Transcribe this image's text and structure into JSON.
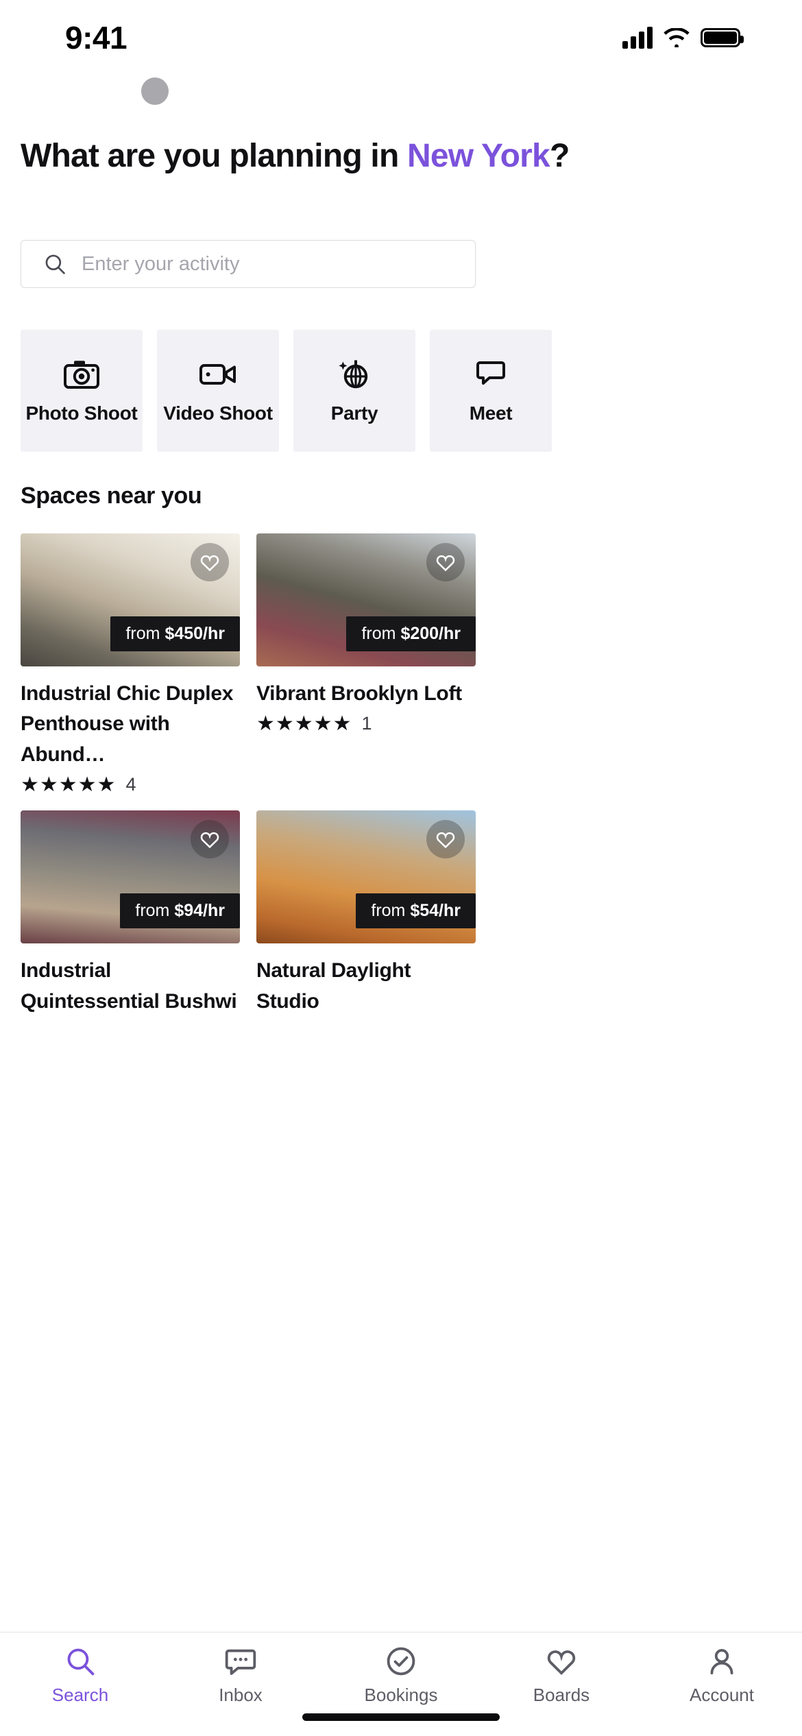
{
  "status_bar": {
    "time": "9:41",
    "signal_icon": "cellular-signal-icon",
    "wifi_icon": "wifi-icon",
    "battery_icon": "battery-icon"
  },
  "header": {
    "avatar_name": "user-avatar",
    "title_line1": "What are you planning in",
    "city": "New York",
    "title_suffix": "?"
  },
  "search": {
    "icon": "search-icon",
    "placeholder": "Enter your activity",
    "value": ""
  },
  "categories": [
    {
      "label": "Photo Shoot",
      "icon": "camera-icon"
    },
    {
      "label": "Video Shoot",
      "icon": "video-camera-icon"
    },
    {
      "label": "Party",
      "icon": "disco-ball-icon"
    },
    {
      "label": "Meet",
      "icon": "meeting-icon"
    }
  ],
  "section": {
    "title": "Spaces near you"
  },
  "listings": [
    {
      "title": "Industrial Chic Duplex Penthouse with Abund…",
      "price_prefix": "from",
      "price": "$450/hr",
      "stars": "★★★★★",
      "reviews": "4",
      "favorite_icon": "heart-icon"
    },
    {
      "title": "Vibrant Brooklyn Loft",
      "price_prefix": "from",
      "price": "$200/hr",
      "stars": "★★★★★",
      "reviews": "1",
      "favorite_icon": "heart-icon"
    },
    {
      "title": "Industrial Quintessential Bushwi",
      "price_prefix": "from",
      "price": "$94/hr",
      "stars": "",
      "reviews": "",
      "favorite_icon": "heart-icon"
    },
    {
      "title": "Natural Daylight Studio",
      "price_prefix": "from",
      "price": "$54/hr",
      "stars": "",
      "reviews": "",
      "favorite_icon": "heart-icon"
    }
  ],
  "tabbar": {
    "items": [
      {
        "label": "Search",
        "icon": "search-icon",
        "active": true
      },
      {
        "label": "Inbox",
        "icon": "chat-icon",
        "active": false
      },
      {
        "label": "Bookings",
        "icon": "check-circle-icon",
        "active": false
      },
      {
        "label": "Boards",
        "icon": "heart-icon",
        "active": false
      },
      {
        "label": "Account",
        "icon": "person-icon",
        "active": false
      }
    ]
  },
  "colors": {
    "accent": "#7B52DB",
    "text": "#111114",
    "muted": "#5d5d66",
    "chip_bg": "#f2f1f6",
    "pill_bg": "#17171a"
  }
}
